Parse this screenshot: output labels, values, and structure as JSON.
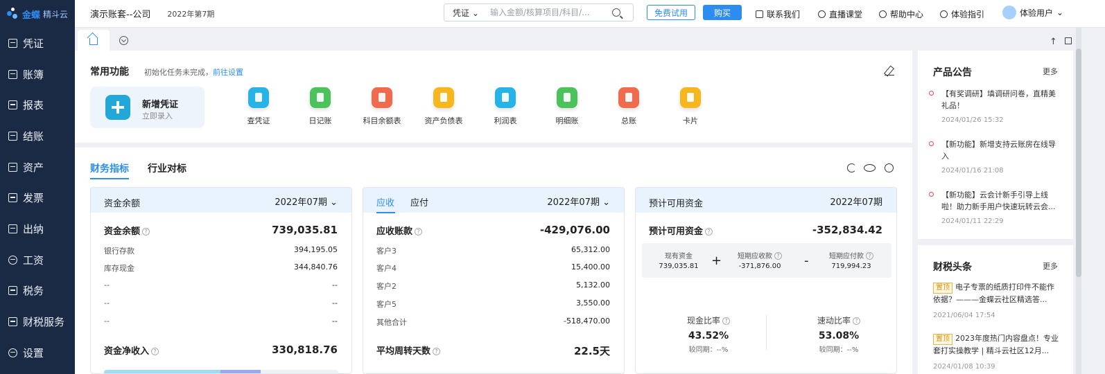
{
  "brand": {
    "name": "金蝶",
    "sub": "精斗云"
  },
  "nav": [
    {
      "label": "凭证",
      "icon": "voucher-icon"
    },
    {
      "label": "账簿",
      "icon": "ledger-icon"
    },
    {
      "label": "报表",
      "icon": "report-icon"
    },
    {
      "label": "结账",
      "icon": "closing-icon"
    },
    {
      "label": "资产",
      "icon": "asset-icon"
    },
    {
      "label": "发票",
      "icon": "invoice-icon"
    },
    {
      "label": "出纳",
      "icon": "cashier-icon"
    },
    {
      "label": "工资",
      "icon": "salary-icon"
    },
    {
      "label": "税务",
      "icon": "tax-icon"
    },
    {
      "label": "财税服务",
      "icon": "service-icon"
    },
    {
      "label": "设置",
      "icon": "settings-icon"
    }
  ],
  "topbar": {
    "account": "演示账套--公司",
    "period": "2022年第7期",
    "search_type": "凭证",
    "search_placeholder": "输入金额/核算项目/科目/...",
    "trial": "免费试用",
    "buy": "购买",
    "links": [
      "联系我们",
      "直播课堂",
      "帮助中心",
      "体验指引"
    ],
    "user": "体验用户"
  },
  "common": {
    "title": "常用功能",
    "hint": "初始化任务未完成，",
    "hint_link": "前往设置",
    "new_voucher": {
      "title": "新增凭证",
      "sub": "立即录入"
    },
    "functions": [
      {
        "label": "查凭证",
        "color": "#27b3e6"
      },
      {
        "label": "日记账",
        "color": "#4cc35a"
      },
      {
        "label": "科目余额表",
        "color": "#ee6b4d"
      },
      {
        "label": "资产负债表",
        "color": "#f6b71e"
      },
      {
        "label": "利润表",
        "color": "#27b3e6"
      },
      {
        "label": "明细账",
        "color": "#4cc35a"
      },
      {
        "label": "总账",
        "color": "#ee6b4d"
      },
      {
        "label": "卡片",
        "color": "#f6b71e"
      }
    ]
  },
  "finance": {
    "tabs": [
      "财务指标",
      "行业对标"
    ],
    "cash": {
      "head": "资金余额",
      "period": "2022年07期",
      "total_label": "资金余额",
      "total": "739,035.81",
      "rows": [
        {
          "label": "银行存款",
          "value": "394,195.05"
        },
        {
          "label": "库存现金",
          "value": "344,840.76"
        },
        {
          "label": "--",
          "value": "--"
        },
        {
          "label": "--",
          "value": "--"
        },
        {
          "label": "--",
          "value": "--"
        }
      ],
      "net_label": "资金净收入",
      "net": "330,818.76"
    },
    "receivable": {
      "tab_ar": "应收",
      "tab_ap": "应付",
      "period": "2022年07期",
      "total_label": "应收账款",
      "total": "-429,076.00",
      "rows": [
        {
          "label": "客户3",
          "value": "65,312.00"
        },
        {
          "label": "客户4",
          "value": "15,400.00"
        },
        {
          "label": "客户2",
          "value": "5,132.00"
        },
        {
          "label": "客户5",
          "value": "3,550.00"
        },
        {
          "label": "其他合计",
          "value": "-518,470.00"
        }
      ],
      "turnover_label": "平均周转天数",
      "turnover": "22.5天"
    },
    "available": {
      "head": "预计可用资金",
      "period": "2022年07期",
      "total_label": "预计可用资金",
      "total": "-352,834.42",
      "parts": [
        {
          "label": "现有资金",
          "value": "739,035.81"
        },
        {
          "label": "短期应收款",
          "value": "-371,876.00"
        },
        {
          "label": "短期应付款",
          "value": "719,994.23"
        }
      ],
      "op_plus": "+",
      "op_minus": "-",
      "ratios": [
        {
          "label": "现金比率",
          "value": "43.52%",
          "compare": "较同期：--%"
        },
        {
          "label": "速动比率",
          "value": "53.08%",
          "compare": "较同期：--%"
        }
      ]
    }
  },
  "notices": {
    "title": "产品公告",
    "more": "更多",
    "items": [
      {
        "text": "【有奖调研】填调研问卷，直精美礼品！",
        "date": "2024/01/26 15:32"
      },
      {
        "text": "【新功能】新增支持云账房在线导入",
        "date": "2024/01/16 21:08"
      },
      {
        "text": "【新功能】云会计新手引导上线啦！助力新手用户快速玩转云会...",
        "date": "2024/01/11 22:29"
      }
    ]
  },
  "tax_news": {
    "title": "财税头条",
    "more": "更多",
    "items": [
      {
        "tag": "置顶",
        "text": "电子专票的纸质打印件不能作依据？———金蝶云社区精选答...",
        "date": "2021/06/04 17:54"
      },
      {
        "tag": "置顶",
        "text": "2023年度热门内容盘点！专业套打实操教学 | 精斗云社区12月...",
        "date": "2024/01/08 10:39"
      }
    ]
  }
}
